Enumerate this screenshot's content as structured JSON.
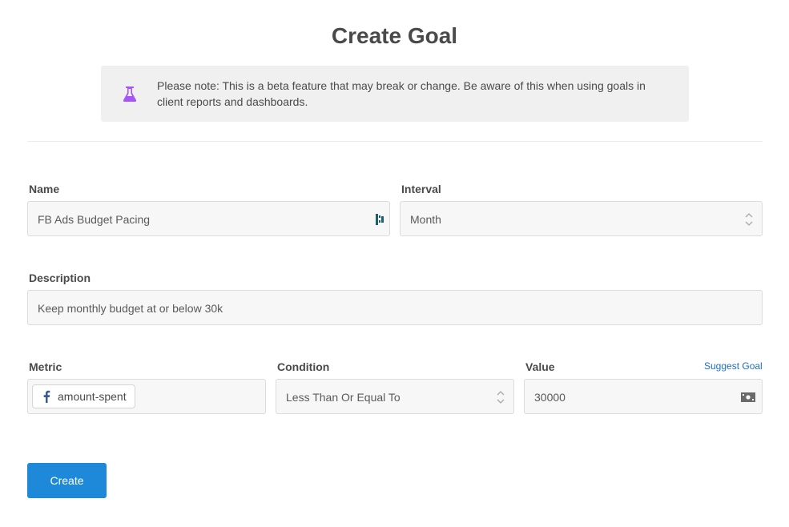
{
  "page": {
    "title": "Create Goal"
  },
  "notice": {
    "icon": "flask-icon",
    "text": "Please note: This is a beta feature that may break or change. Be aware of this when using goals in client reports and dashboards.",
    "icon_color": "#a855f7"
  },
  "form": {
    "name": {
      "label": "Name",
      "value": "FB Ads Budget Pacing",
      "icon": "password-manager-icon"
    },
    "interval": {
      "label": "Interval",
      "value": "Month",
      "icon": "chevron-up-down-icon"
    },
    "description": {
      "label": "Description",
      "value": "Keep monthly budget at or below 30k"
    },
    "metric": {
      "label": "Metric",
      "chip_label": "amount-spent",
      "chip_icon": "facebook-icon",
      "chip_icon_color": "#3b5998"
    },
    "condition": {
      "label": "Condition",
      "value": "Less Than Or Equal To",
      "icon": "chevron-up-down-icon"
    },
    "value": {
      "label": "Value",
      "value": "30000",
      "icon": "money-icon",
      "suggest_link": "Suggest Goal"
    }
  },
  "actions": {
    "create_label": "Create",
    "primary_color": "#1e88d9"
  }
}
